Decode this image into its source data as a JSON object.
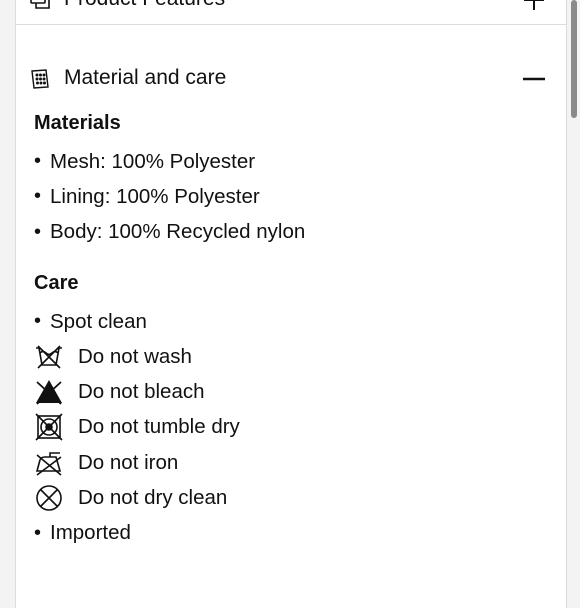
{
  "accordion": {
    "features_label": "Product Features",
    "material_label": "Material and care"
  },
  "materials": {
    "title": "Materials",
    "items": [
      "Mesh: 100% Polyester",
      "Lining: 100% Polyester",
      "Body: 100% Recycled nylon"
    ]
  },
  "care": {
    "title": "Care",
    "spot_clean": "Spot clean",
    "do_not_wash": "Do not wash",
    "do_not_bleach": "Do not bleach",
    "do_not_tumble_dry": "Do not tumble dry",
    "do_not_iron": "Do not iron",
    "do_not_dry_clean": "Do not dry clean",
    "imported": "Imported"
  },
  "icons": {
    "features": "product-features-icon",
    "material": "material-care-icon",
    "features_toggle": "plus-icon",
    "material_toggle": "minus-icon",
    "wash": "do-not-wash-icon",
    "bleach": "do-not-bleach-icon",
    "tumble": "do-not-tumble-dry-icon",
    "iron": "do-not-iron-icon",
    "dryclean": "do-not-dry-clean-icon"
  }
}
